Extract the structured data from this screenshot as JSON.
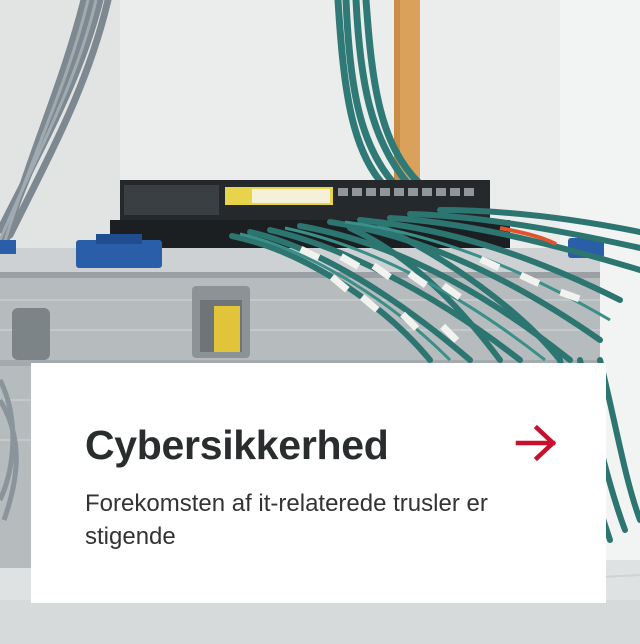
{
  "card": {
    "image_subject": "server-rack-with-network-cables",
    "title": "Cybersikkerhed",
    "description": "Forekomsten af it-relaterede trusler er stigende",
    "arrow_icon": "arrow-right-icon",
    "accent_color": "#c8102e"
  }
}
